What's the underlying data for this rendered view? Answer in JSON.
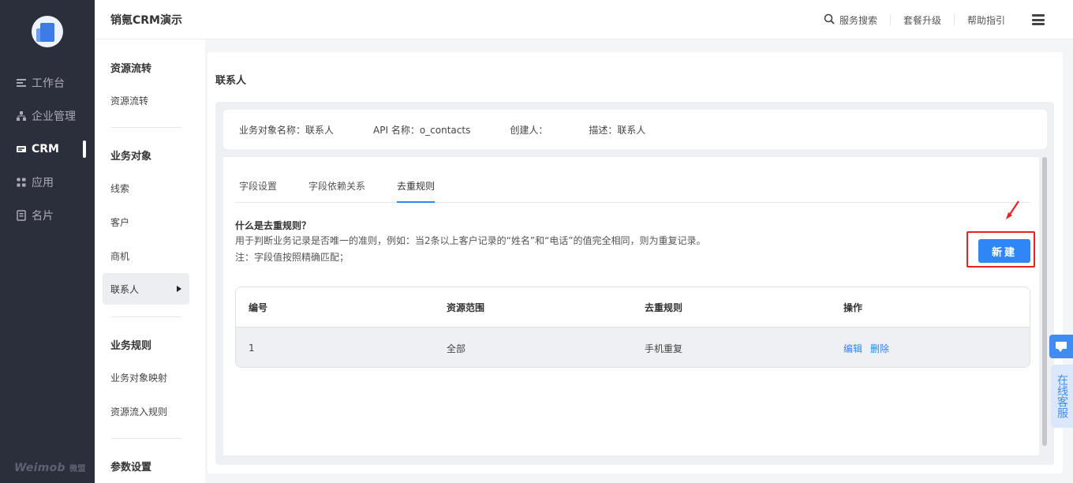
{
  "rail": {
    "items": [
      {
        "label": "工作台",
        "icon": "workbench-icon"
      },
      {
        "label": "企业管理",
        "icon": "org-icon"
      },
      {
        "label": "CRM",
        "icon": "crm-icon"
      },
      {
        "label": "应用",
        "icon": "apps-icon"
      },
      {
        "label": "名片",
        "icon": "card-icon"
      }
    ],
    "brand": "Weimob",
    "brand_cn": "微盟"
  },
  "header": {
    "title": "销氪CRM演示",
    "search_label": "服务搜索",
    "upgrade_label": "套餐升级",
    "help_label": "帮助指引"
  },
  "subnav": {
    "group1": "资源流转",
    "group1_item": "资源流转",
    "group2": "业务对象",
    "group2_items": [
      "线索",
      "客户",
      "商机",
      "联系人"
    ],
    "group3": "业务规则",
    "group3_items": [
      "业务对象映射",
      "资源流入规则"
    ],
    "group4": "参数设置"
  },
  "main": {
    "page_title": "联系人",
    "info": {
      "object_name": "业务对象名称：联系人",
      "api_name": "API 名称：o_contacts",
      "creator": "创建人：",
      "description": "描述：联系人"
    },
    "tabs": [
      "字段设置",
      "字段依赖关系",
      "去重规则"
    ],
    "active_tab": "去重规则",
    "rule_title": "什么是去重规则？",
    "rule_desc": "用于判断业务记录是否唯一的准则，例如：当2条以上客户记录的“姓名”和“电话”的值完全相同，则为重复记录。",
    "rule_note": "注：字段值按照精确匹配；",
    "new_button": "新建",
    "table": {
      "headers": [
        "编号",
        "资源范围",
        "去重规则",
        "操作"
      ],
      "rows": [
        {
          "no": "1",
          "scope": "全部",
          "rule": "手机重复",
          "edit": "编辑",
          "delete": "删除"
        }
      ]
    }
  },
  "float": {
    "service_label": "在线客服"
  },
  "colors": {
    "accent": "#2f86f6",
    "rail_bg": "#2b2e3b",
    "highlight": "#e8231f"
  }
}
